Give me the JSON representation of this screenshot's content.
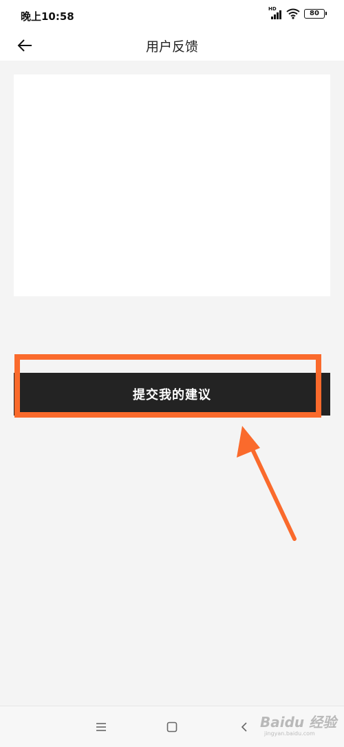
{
  "status_bar": {
    "time": "晚上10:58",
    "network_label": "HD",
    "battery": "80"
  },
  "header": {
    "title": "用户反馈",
    "back_icon": "arrow-left-icon"
  },
  "feedback": {
    "value": "",
    "placeholder": ""
  },
  "submit": {
    "label": "提交我的建议"
  },
  "annotation": {
    "color": "#fa6a2c"
  },
  "nav_bar": {
    "icons": [
      "menu-icon",
      "home-square-icon",
      "back-chevron-icon"
    ]
  },
  "watermark": {
    "main": "Baidu 经验",
    "sub": "jingyan.baidu.com"
  },
  "colors": {
    "background": "#f4f4f4",
    "button": "#232323",
    "accent": "#fa6a2c"
  }
}
